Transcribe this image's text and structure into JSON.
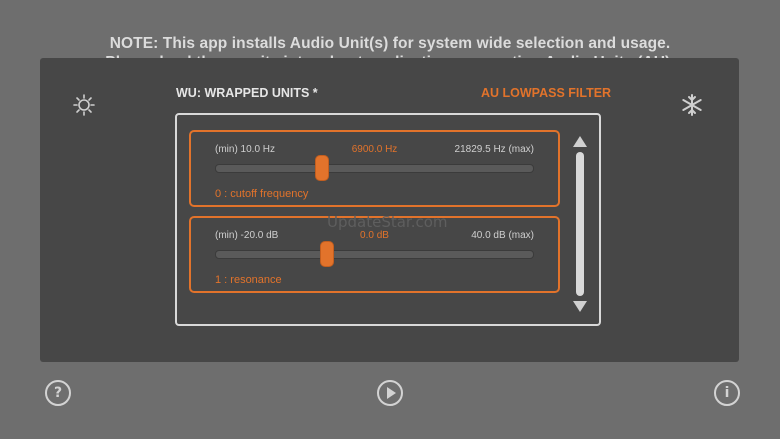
{
  "note": {
    "line1": "NOTE: This app installs Audio Unit(s) for system wide selection and usage.",
    "line2": "Please load these units into a host application, supporting Audio Units (AU)."
  },
  "header": {
    "title": "WU: WRAPPED UNITS *",
    "filter_name": "AU LOWPASS FILTER"
  },
  "params": [
    {
      "min": "(min) 10.0 Hz",
      "current": "6900.0 Hz",
      "max": "21829.5 Hz (max)",
      "label": "0 : cutoff frequency",
      "position": 0.3
    },
    {
      "min": "(min) -20.0 dB",
      "current": "0.0 dB",
      "max": "40.0 dB (max)",
      "label": "1 : resonance",
      "position": 0.33
    }
  ],
  "watermark": "UpdateStar.com",
  "icons": {
    "left": "sun-icon",
    "right": "snowflake-icon",
    "help": "help-icon",
    "play": "play-icon",
    "info": "info-icon"
  },
  "colors": {
    "accent": "#e2732b",
    "panel": "#474747",
    "background": "#6e6e6e"
  }
}
